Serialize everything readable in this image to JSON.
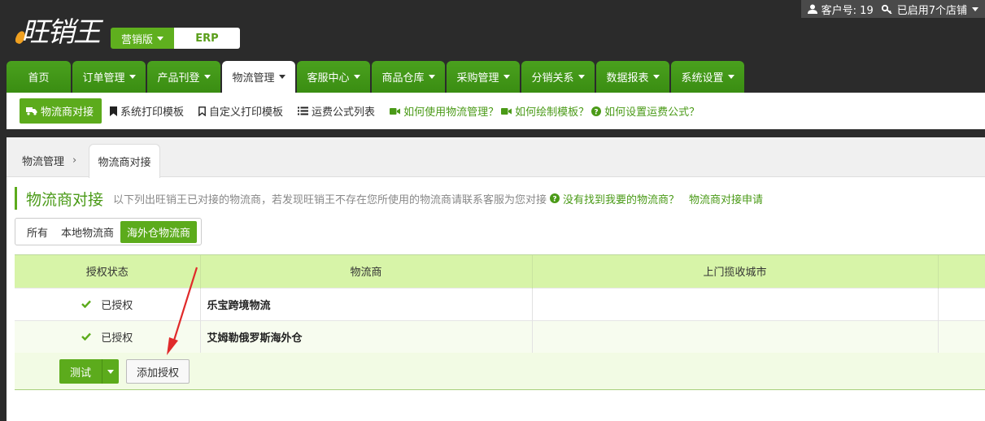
{
  "header": {
    "logo_text": "旺销王",
    "edition_label": "营销版",
    "erp_label": "ERP",
    "user": {
      "account_label": "客户号: 19",
      "stores_label": "已启用7个店铺"
    }
  },
  "nav": {
    "tabs": [
      {
        "label": "首页",
        "has_caret": false,
        "active": false
      },
      {
        "label": "订单管理",
        "has_caret": true,
        "active": false
      },
      {
        "label": "产品刊登",
        "has_caret": true,
        "active": false
      },
      {
        "label": "物流管理",
        "has_caret": true,
        "active": true
      },
      {
        "label": "客服中心",
        "has_caret": true,
        "active": false
      },
      {
        "label": "商品仓库",
        "has_caret": true,
        "active": false
      },
      {
        "label": "采购管理",
        "has_caret": true,
        "active": false
      },
      {
        "label": "分销关系",
        "has_caret": true,
        "active": false
      },
      {
        "label": "数据报表",
        "has_caret": true,
        "active": false
      },
      {
        "label": "系统设置",
        "has_caret": true,
        "active": false
      }
    ]
  },
  "subnav": {
    "active_label": "物流商对接",
    "links": [
      "系统打印模板",
      "自定义打印模板",
      "运费公式列表"
    ],
    "help_links": [
      "如何使用物流管理？",
      "如何绘制模板？",
      "如何设置运费公式？"
    ]
  },
  "breadcrumb": {
    "root": "物流管理",
    "separator": "›",
    "current": "物流商对接"
  },
  "page": {
    "title": "物流商对接",
    "description": "以下列出旺销王已对接的物流商，若发现旺销王不存在您所使用的物流商请联系客服为您对接",
    "question_link": "没有找到我要的物流商？",
    "apply_link": "物流商对接申请"
  },
  "filters": {
    "options": [
      "所有",
      "本地物流商",
      "海外仓物流商"
    ],
    "selected": "海外仓物流商"
  },
  "table": {
    "columns": [
      "授权状态",
      "物流商",
      "上门揽收城市"
    ],
    "rows": [
      {
        "status": "已授权",
        "carrier": "乐宝跨境物流",
        "city": ""
      },
      {
        "status": "已授权",
        "carrier": "艾姆勒俄罗斯海外仓",
        "city": ""
      }
    ]
  },
  "actions": {
    "test_label": "测试",
    "add_auth_label": "添加授权"
  },
  "colors": {
    "brand_green": "#5cab1c",
    "header_bg": "#2b2b2b",
    "table_header_bg": "#d7f4a8",
    "annotation_arrow": "#e02a2a"
  }
}
